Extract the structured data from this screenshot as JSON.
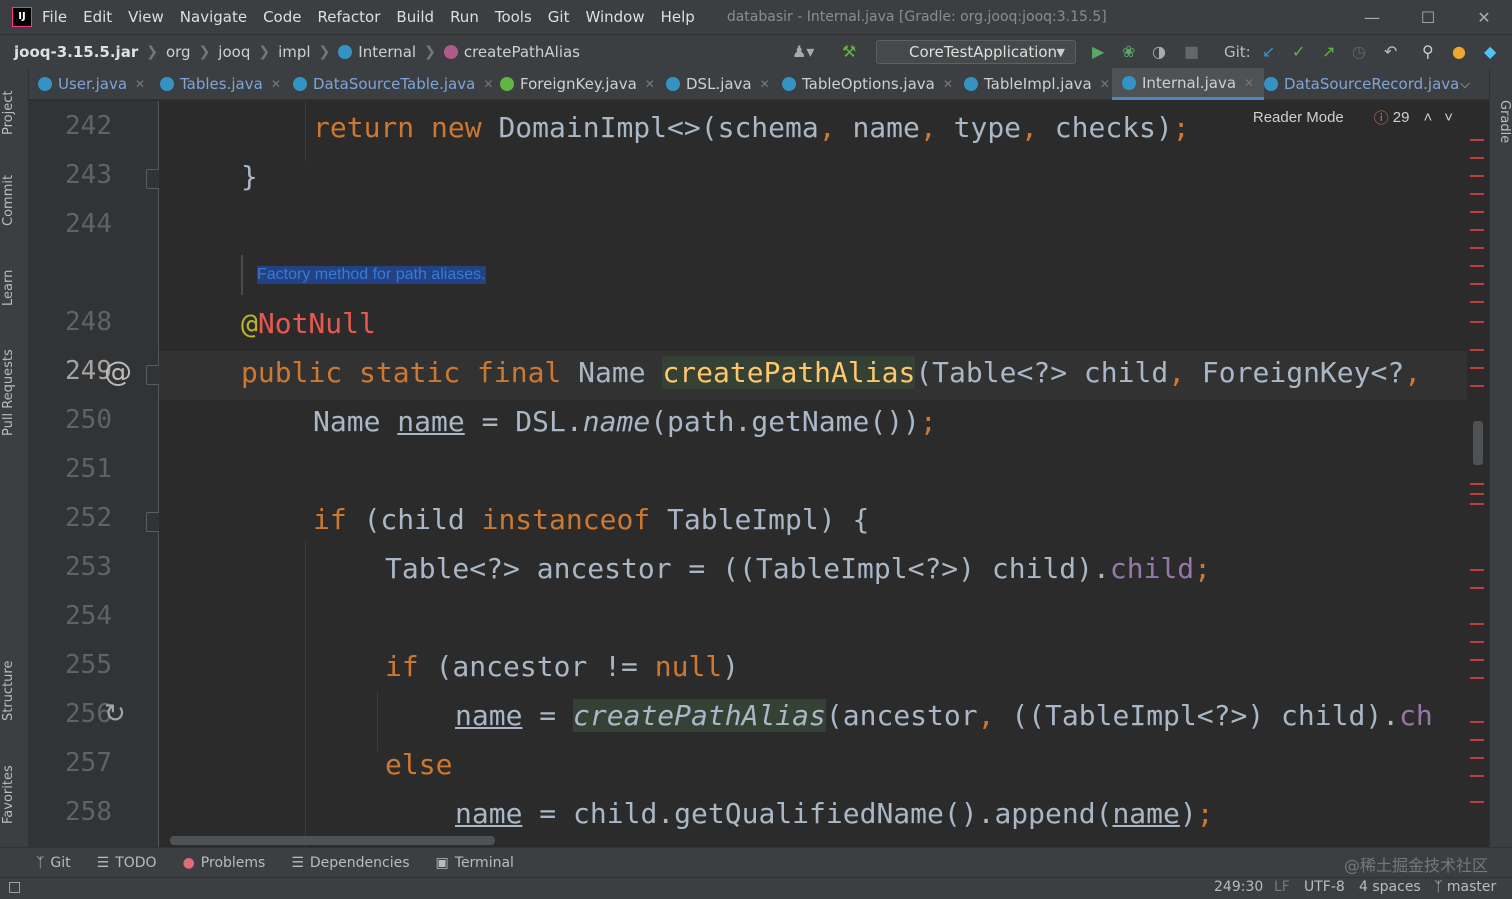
{
  "menu": {
    "items": [
      "File",
      "Edit",
      "View",
      "Navigate",
      "Code",
      "Refactor",
      "Build",
      "Run",
      "Tools",
      "Git",
      "Window",
      "Help"
    ],
    "window_title": "databasir - Internal.java [Gradle: org.jooq:jooq:3.15.5]"
  },
  "breadcrumb": [
    "jooq-3.15.5.jar",
    "org",
    "jooq",
    "impl",
    "Internal",
    "createPathAlias"
  ],
  "toolbar": {
    "run_config": "CoreTestApplication",
    "git_label": "Git:"
  },
  "tabs": [
    "User.java",
    "Tables.java",
    "DataSourceTable.java",
    "ForeignKey.java",
    "DSL.java",
    "TableOptions.java",
    "TableImpl.java",
    "Internal.java",
    "DataSourceRecord.java"
  ],
  "active_tab": "Internal.java",
  "left_tools": [
    "Project",
    "Commit",
    "Learn",
    "Pull Requests",
    "Structure",
    "Favorites"
  ],
  "right_tools": [
    "Gradle"
  ],
  "editor": {
    "reader_mode": "Reader Mode",
    "problems_count": "29",
    "doc_comment": "Factory method for path aliases.",
    "line_numbers": [
      "242",
      "243",
      "244",
      "248",
      "249",
      "250",
      "251",
      "252",
      "253",
      "254",
      "255",
      "256",
      "257",
      "258"
    ],
    "current_line": "249"
  },
  "bottom_tools": [
    "Git",
    "TODO",
    "Problems",
    "Dependencies",
    "Terminal"
  ],
  "status": {
    "position": "249:30",
    "line_sep": "LF",
    "encoding": "UTF-8",
    "indent": "4 spaces",
    "branch": "master"
  },
  "watermark": "@稀土掘金技术社区",
  "colors": {
    "keyword": "#cc7832",
    "function": "#ffc66d",
    "annotation": "#bbb529",
    "field": "#9876aa",
    "text": "#a9b7c6",
    "background": "#2b2b2b"
  }
}
